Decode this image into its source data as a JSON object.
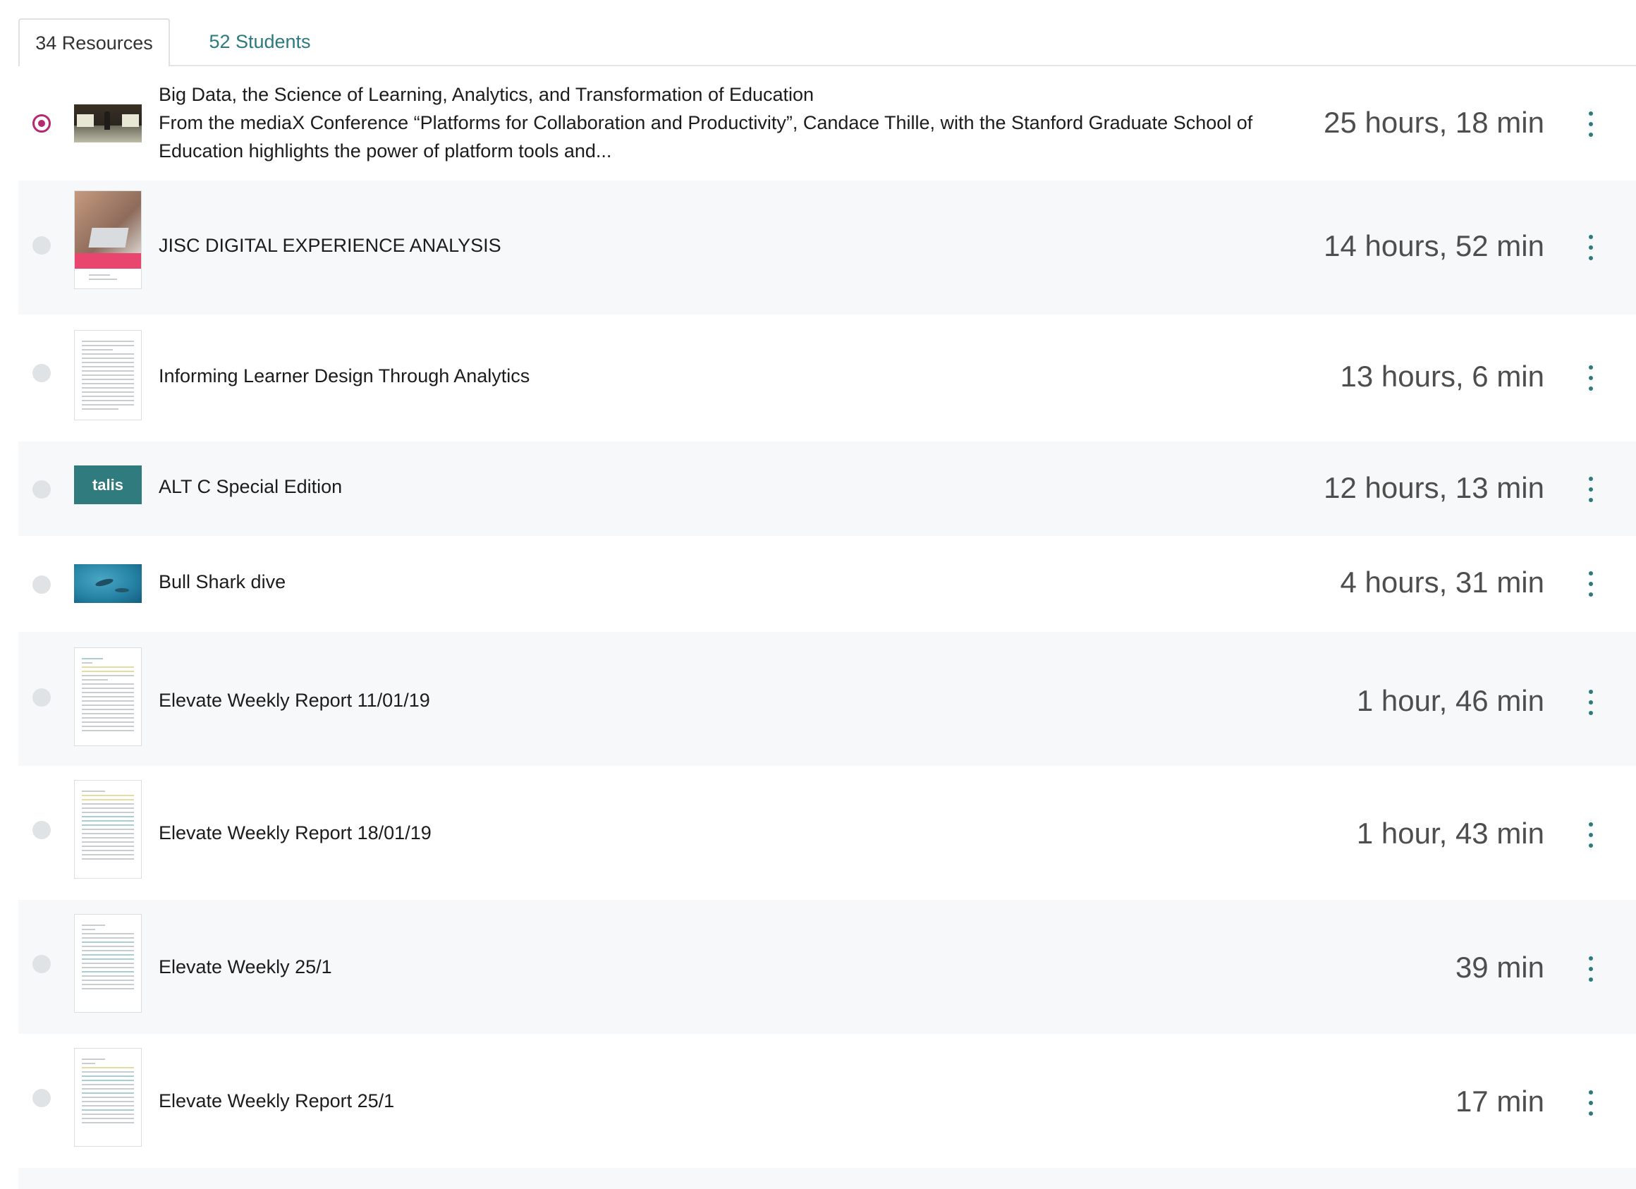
{
  "tabs": {
    "resources": "34 Resources",
    "students": "52 Students"
  },
  "resources": [
    {
      "title": "Big Data, the Science of Learning, Analytics, and Transformation of Education",
      "description": "From the mediaX Conference “Platforms for Collaboration and Productivity”, Candace Thille, with the Stanford Graduate School of Education highlights the power of platform tools and...",
      "duration": "25 hours, 18 min",
      "selected": true
    },
    {
      "title": "JISC DIGITAL EXPERIENCE ANALYSIS",
      "duration": "14 hours, 52 min"
    },
    {
      "title": "Informing Learner Design Through Analytics",
      "duration": "13 hours, 6 min"
    },
    {
      "title": "ALT C Special Edition",
      "duration": "12 hours, 13 min",
      "thumbnail_text": "talis"
    },
    {
      "title": "Bull Shark dive",
      "duration": "4 hours, 31 min"
    },
    {
      "title": "Elevate Weekly Report 11/01/19",
      "duration": "1 hour, 46 min"
    },
    {
      "title": "Elevate Weekly Report 18/01/19",
      "duration": "1 hour, 43 min"
    },
    {
      "title": "Elevate Weekly 25/1",
      "duration": "39 min"
    },
    {
      "title": "Elevate Weekly Report 25/1",
      "duration": "17 min"
    }
  ],
  "colors": {
    "accent": "#2b7a7e",
    "selected_radio": "#b7286f",
    "row_shade": "#f6f8f9",
    "talis_tile": "#2f7b7e"
  }
}
